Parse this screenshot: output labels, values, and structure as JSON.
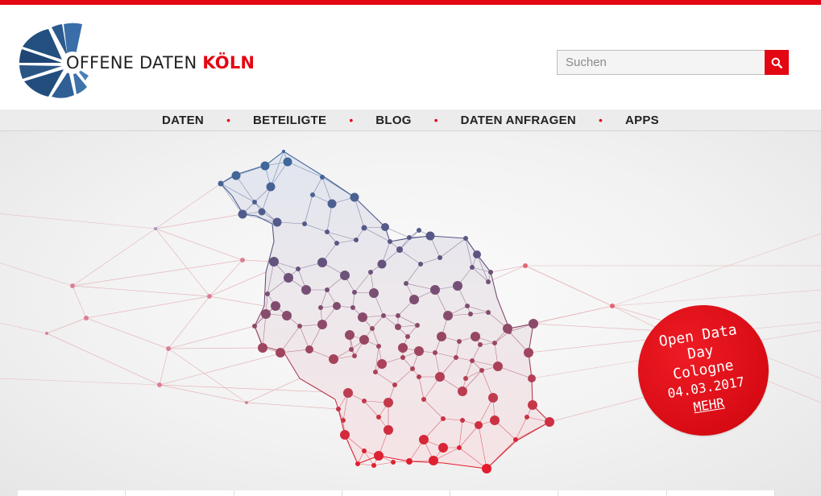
{
  "header": {
    "logo_prefix": "OFFENE DATEN ",
    "logo_city": "KÖLN",
    "brand_color": "#e30613",
    "search_placeholder": "Suchen",
    "search_value": "",
    "search_icon": "search-icon"
  },
  "nav": {
    "items": [
      {
        "label": "DATEN"
      },
      {
        "label": "BETEILIGTE"
      },
      {
        "label": "BLOG"
      },
      {
        "label": "DATEN ANFRAGEN"
      },
      {
        "label": "APPS"
      }
    ],
    "separator": "•"
  },
  "badge": {
    "line1": "Open Data",
    "line2": "Day",
    "line3": "Cologne",
    "line4": "04.03.2017",
    "link": "MEHR"
  }
}
